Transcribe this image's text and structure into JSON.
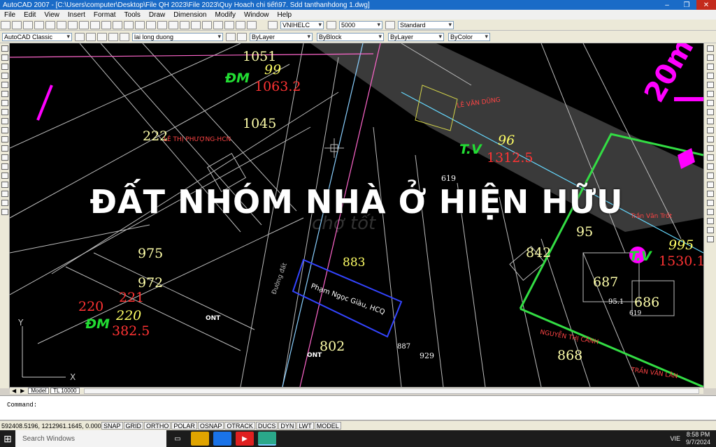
{
  "window": {
    "title": "AutoCAD 2007 - [C:\\Users\\computer\\Desktop\\File QH 2023\\File 2023\\Quy Hoach chi tiết\\97. Sdd tanthanhdong 1.dwg]",
    "min": "–",
    "max": "❐",
    "close": "✕"
  },
  "menu": [
    "File",
    "Edit",
    "View",
    "Insert",
    "Format",
    "Tools",
    "Draw",
    "Dimension",
    "Modify",
    "Window",
    "Help"
  ],
  "toolbar1": {
    "font_combo": "VNIHELC",
    "height_combo": "5000",
    "style_combo": "Standard"
  },
  "toolbar2": {
    "workspace": "AutoCAD Classic",
    "layer": "lai long duong",
    "color": "ByLayer",
    "linetype": "ByBlock",
    "lineweight": "ByLayer",
    "plotstyle": "ByColor"
  },
  "drawing": {
    "overlay_text": "ĐẤT NHÓM NHÀ Ở HIỆN HỮU",
    "watermark": "chợ tốt",
    "lot_numbers": [
      "1051",
      "99",
      "1063.2",
      "1045",
      "222",
      "96",
      "1312.5",
      "619",
      "975",
      "972",
      "221",
      "220",
      "220",
      "382.5",
      "883",
      "842",
      "95",
      "995",
      "1530.1",
      "687",
      "686",
      "802",
      "868",
      "929",
      "887",
      "95.1",
      "619"
    ],
    "labels": [
      "ĐM",
      "T.V",
      "T.V",
      "ĐM",
      "ONT",
      "ONT",
      "20m",
      "LÊ VĂN DŨNG",
      "Phạm Ngọc Giàu, HCQ",
      "Đường đất",
      "Trần Văn Trốt",
      "NGUYỄN THỊ CÁNH",
      "TRẦN VĂN LÂN",
      "LÊ THỊ PHƯỢNG-HCN"
    ],
    "axis_x": "X",
    "axis_y": "Y"
  },
  "layout_tabs": {
    "model": "Model",
    "layout": "TL 10000"
  },
  "command": {
    "prompt": "Command:"
  },
  "status": {
    "coords": "592408.5196, 1212961.1645, 0.0000",
    "buttons": [
      "SNAP",
      "GRID",
      "ORTHO",
      "POLAR",
      "OSNAP",
      "OTRACK",
      "DUCS",
      "DYN",
      "LWT",
      "MODEL"
    ]
  },
  "taskbar": {
    "search": "Search Windows",
    "lang": "VIE",
    "time": "8:58 PM",
    "date": "9/7/2024"
  }
}
